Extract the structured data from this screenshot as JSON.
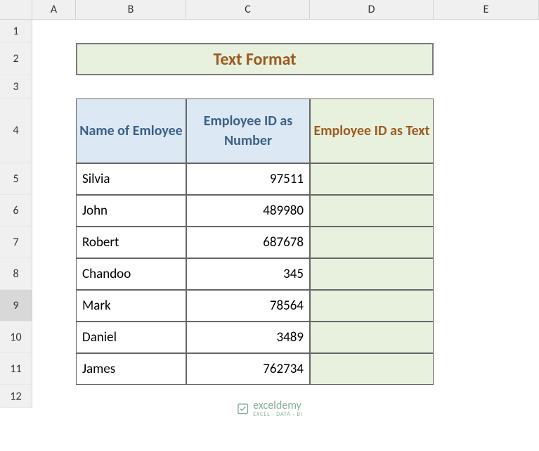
{
  "columns": [
    "A",
    "B",
    "C",
    "D",
    "E"
  ],
  "rows": [
    "1",
    "2",
    "3",
    "4",
    "5",
    "6",
    "7",
    "8",
    "9",
    "10",
    "11",
    "12"
  ],
  "title": "Text Format",
  "headers": {
    "b": "Name of Emloyee",
    "c": "Employee ID as Number",
    "d": "Employee ID as Text"
  },
  "data": [
    {
      "name": "Silvia",
      "id": "97511"
    },
    {
      "name": "John",
      "id": "489980"
    },
    {
      "name": "Robert",
      "id": "687678"
    },
    {
      "name": "Chandoo",
      "id": "345"
    },
    {
      "name": "Mark",
      "id": "78564"
    },
    {
      "name": "Daniel",
      "id": "3489"
    },
    {
      "name": "James",
      "id": "762734"
    }
  ],
  "watermark": {
    "brand": "exceldemy",
    "sub": "EXCEL · DATA · BI"
  },
  "chart_data": {
    "type": "table",
    "title": "Text Format",
    "columns": [
      "Name of Emloyee",
      "Employee ID as Number",
      "Employee ID as Text"
    ],
    "rows": [
      [
        "Silvia",
        97511,
        ""
      ],
      [
        "John",
        489980,
        ""
      ],
      [
        "Robert",
        687678,
        ""
      ],
      [
        "Chandoo",
        345,
        ""
      ],
      [
        "Mark",
        78564,
        ""
      ],
      [
        "Daniel",
        3489,
        ""
      ],
      [
        "James",
        762734,
        ""
      ]
    ]
  }
}
